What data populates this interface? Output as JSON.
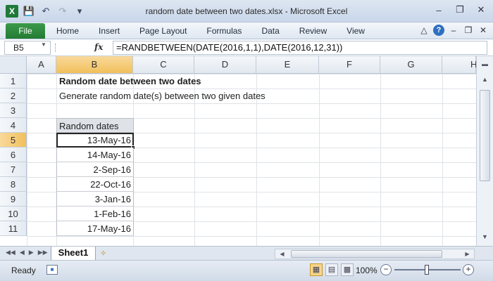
{
  "window": {
    "title": "random date between two dates.xlsx - Microsoft Excel",
    "app_icon": "excel-icon",
    "qat": [
      "save-icon",
      "undo-icon",
      "redo-icon",
      "customize-icon"
    ],
    "controls": [
      "minimize-icon",
      "restore-icon",
      "close-icon"
    ]
  },
  "ribbon": {
    "file_label": "File",
    "tabs": [
      "Home",
      "Insert",
      "Page Layout",
      "Formulas",
      "Data",
      "Review",
      "View"
    ]
  },
  "formula_bar": {
    "name_box": "B5",
    "fx_label": "fx",
    "formula": "=RANDBETWEEN(DATE(2016,1,1),DATE(2016,12,31))"
  },
  "columns": [
    "A",
    "B",
    "C",
    "D",
    "E",
    "F",
    "G",
    "H"
  ],
  "selected_column": "B",
  "rows": [
    "1",
    "2",
    "3",
    "4",
    "5",
    "6",
    "7",
    "8",
    "9",
    "10",
    "11"
  ],
  "selected_row": "5",
  "cells": {
    "B1": "Random date between two dates",
    "B2": "Generate random date(s) between two given dates",
    "B4": "Random dates",
    "dates": [
      "13-May-16",
      "14-May-16",
      "2-Sep-16",
      "22-Oct-16",
      "3-Jan-16",
      "1-Feb-16",
      "17-May-16"
    ]
  },
  "sheets": {
    "active": "Sheet1"
  },
  "status": {
    "ready": "Ready",
    "zoom": "100%",
    "zoom_level": 0.5
  },
  "colors": {
    "file_tab": "#237b33",
    "selected_header": "#f1c05c",
    "table_header_fill": "#dfe3e8"
  }
}
